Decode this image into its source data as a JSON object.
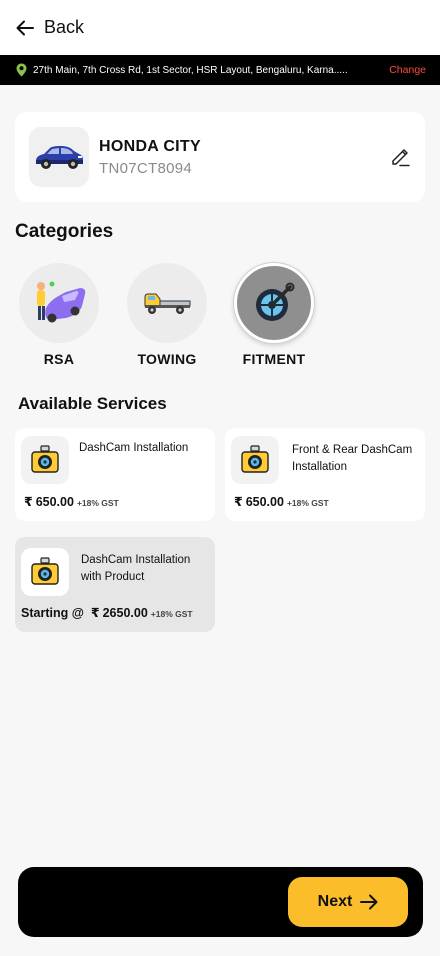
{
  "header": {
    "back_label": "Back"
  },
  "address": {
    "text": "27th Main, 7th Cross Rd, 1st Sector, HSR Layout, Bengaluru, Karna.....",
    "change_label": "Change"
  },
  "vehicle": {
    "name": "HONDA CITY",
    "plate": "TN07CT8094"
  },
  "categories": {
    "title": "Categories",
    "items": [
      {
        "label": "RSA"
      },
      {
        "label": "TOWING"
      },
      {
        "label": "FITMENT"
      }
    ],
    "selected": "FITMENT"
  },
  "services": {
    "title": "Available Services",
    "items": [
      {
        "title_line1": "DashCam Installation",
        "title_line2": "",
        "price": "650.00",
        "gst": "+18% GST"
      },
      {
        "title_line1": "Front & Rear DashCam",
        "title_line2": "Installation",
        "price": "650.00",
        "gst": "+18% GST"
      },
      {
        "title_line1": "DashCam Installation",
        "title_line2": "with Product",
        "prefix": "Starting @",
        "price": "2650.00",
        "gst": "+18% GST"
      }
    ]
  },
  "footer": {
    "next_label": "Next"
  },
  "colors": {
    "accent": "#fbbd2a",
    "change_link": "#ff4a3d",
    "pin": "#8bc34a"
  }
}
